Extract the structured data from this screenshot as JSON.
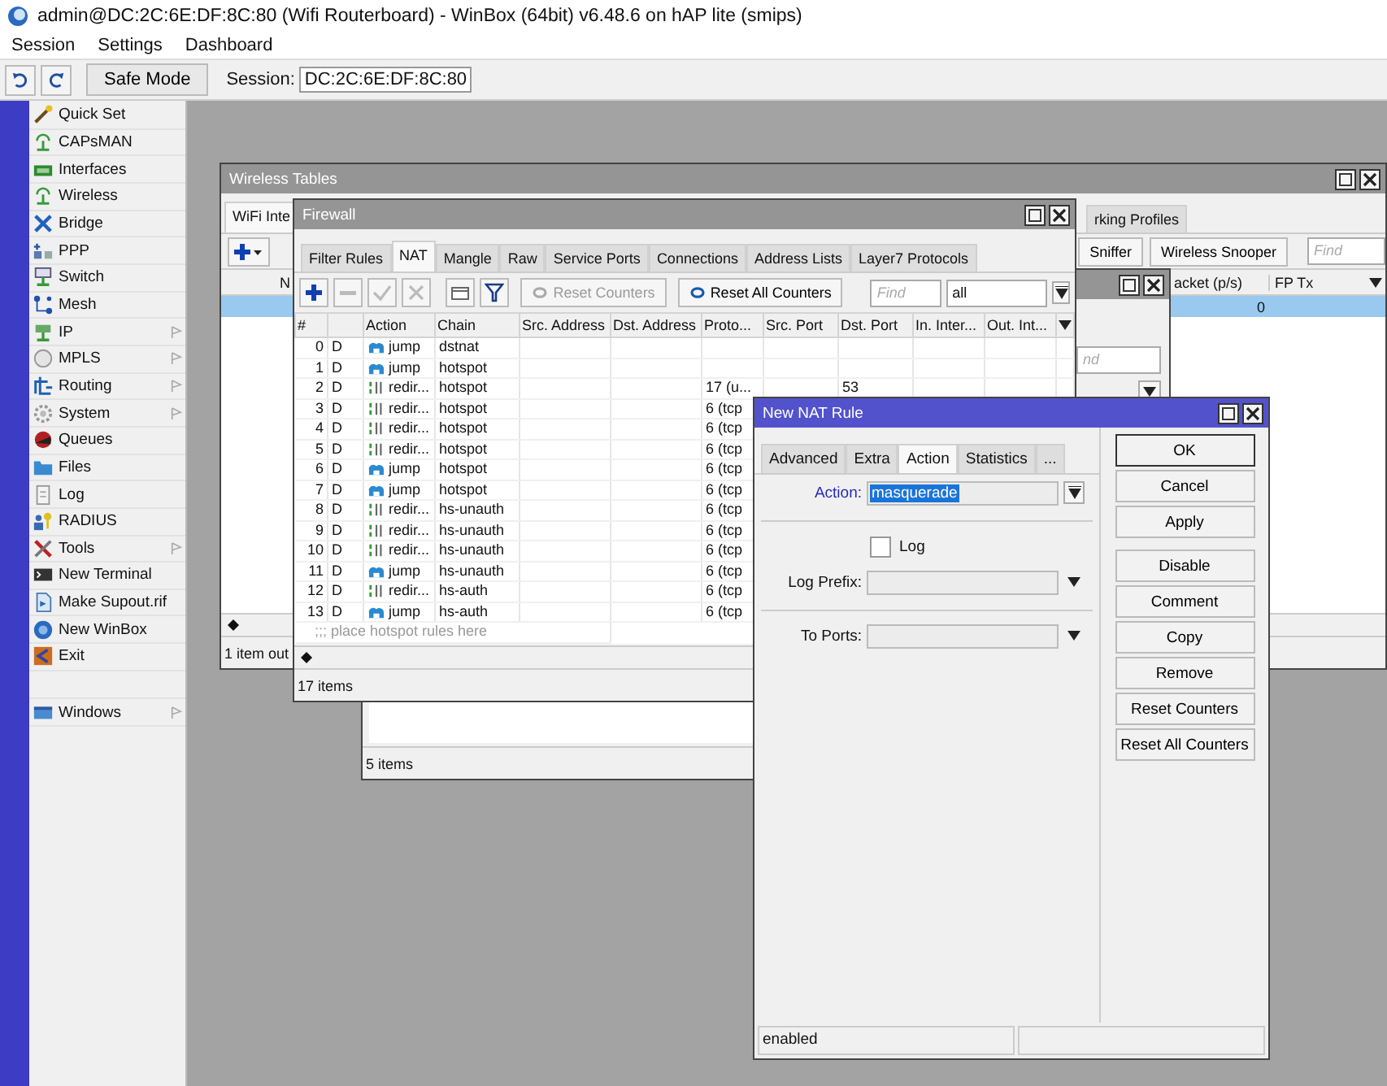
{
  "app": {
    "title": "admin@DC:2C:6E:DF:8C:80 (Wifi Routerboard) - WinBox (64bit) v6.48.6 on hAP lite (smips)"
  },
  "menu": [
    "Session",
    "Settings",
    "Dashboard"
  ],
  "toolbar": {
    "safe_mode": "Safe Mode",
    "session_label": "Session:",
    "session_value": "DC:2C:6E:DF:8C:80"
  },
  "sidebar": {
    "items": [
      {
        "label": "Quick Set",
        "submenu": false
      },
      {
        "label": "CAPsMAN",
        "submenu": false
      },
      {
        "label": "Interfaces",
        "submenu": false
      },
      {
        "label": "Wireless",
        "submenu": false
      },
      {
        "label": "Bridge",
        "submenu": false
      },
      {
        "label": "PPP",
        "submenu": false
      },
      {
        "label": "Switch",
        "submenu": false
      },
      {
        "label": "Mesh",
        "submenu": false
      },
      {
        "label": "IP",
        "submenu": true
      },
      {
        "label": "MPLS",
        "submenu": true
      },
      {
        "label": "Routing",
        "submenu": true
      },
      {
        "label": "System",
        "submenu": true
      },
      {
        "label": "Queues",
        "submenu": false
      },
      {
        "label": "Files",
        "submenu": false
      },
      {
        "label": "Log",
        "submenu": false
      },
      {
        "label": "RADIUS",
        "submenu": false
      },
      {
        "label": "Tools",
        "submenu": true
      },
      {
        "label": "New Terminal",
        "submenu": false
      },
      {
        "label": "Make Supout.rif",
        "submenu": false
      },
      {
        "label": "New WinBox",
        "submenu": false
      },
      {
        "label": "Exit",
        "submenu": false
      }
    ],
    "bottom_items": [
      {
        "label": "Windows",
        "submenu": true
      }
    ]
  },
  "wireless_tables": {
    "title": "Wireless Tables",
    "active": false,
    "tabs": [
      {
        "label": "WiFi Inte",
        "selected": true
      },
      {
        "label": "rking Profiles",
        "selected": false
      }
    ],
    "buttons": [
      "Sniffer",
      "Wireless Snooper"
    ],
    "find_placeholder": "Find",
    "columns": [
      "N",
      "acket (p/s)",
      "FP Tx"
    ],
    "rows": [
      {
        "selected": true,
        "column_2": "0"
      }
    ],
    "status": "1 item out"
  },
  "back_window": {
    "active": false,
    "find_placeholder": "nd",
    "status": "5 items"
  },
  "firewall": {
    "title": "Firewall",
    "active": false,
    "tabs": [
      {
        "label": "Filter Rules",
        "selected": false
      },
      {
        "label": "NAT",
        "selected": true
      },
      {
        "label": "Mangle",
        "selected": false
      },
      {
        "label": "Raw",
        "selected": false
      },
      {
        "label": "Service Ports",
        "selected": false
      },
      {
        "label": "Connections",
        "selected": false
      },
      {
        "label": "Address Lists",
        "selected": false
      },
      {
        "label": "Layer7 Protocols",
        "selected": false
      }
    ],
    "counter_buttons": [
      {
        "label": "Reset Counters",
        "disabled": true
      },
      {
        "label": "Reset All Counters",
        "disabled": false
      }
    ],
    "find_placeholder": "Find",
    "filter_value": "all",
    "columns": [
      "#",
      "Action",
      "Chain",
      "Src. Address",
      "Dst. Address",
      "Proto...",
      "Src. Port",
      "Dst. Port",
      "In. Inter...",
      "Out. Int..."
    ],
    "rows": [
      {
        "number": "0",
        "flag": "D",
        "kind": "jump",
        "action": "jump",
        "chain": "dstnat"
      },
      {
        "number": "1",
        "flag": "D",
        "kind": "jump",
        "action": "jump",
        "chain": "hotspot"
      },
      {
        "number": "2",
        "flag": "D",
        "kind": "redirect",
        "action": "redir...",
        "chain": "hotspot",
        "proto": "17 (u...",
        "dst_port": "53"
      },
      {
        "number": "3",
        "flag": "D",
        "kind": "redirect",
        "action": "redir...",
        "chain": "hotspot",
        "proto": "6 (tcp"
      },
      {
        "number": "4",
        "flag": "D",
        "kind": "redirect",
        "action": "redir...",
        "chain": "hotspot",
        "proto": "6 (tcp"
      },
      {
        "number": "5",
        "flag": "D",
        "kind": "redirect",
        "action": "redir...",
        "chain": "hotspot",
        "proto": "6 (tcp"
      },
      {
        "number": "6",
        "flag": "D",
        "kind": "jump",
        "action": "jump",
        "chain": "hotspot",
        "proto": "6 (tcp"
      },
      {
        "number": "7",
        "flag": "D",
        "kind": "jump",
        "action": "jump",
        "chain": "hotspot",
        "proto": "6 (tcp"
      },
      {
        "number": "8",
        "flag": "D",
        "kind": "redirect",
        "action": "redir...",
        "chain": "hs-unauth",
        "proto": "6 (tcp"
      },
      {
        "number": "9",
        "flag": "D",
        "kind": "redirect",
        "action": "redir...",
        "chain": "hs-unauth",
        "proto": "6 (tcp"
      },
      {
        "number": "10",
        "flag": "D",
        "kind": "redirect",
        "action": "redir...",
        "chain": "hs-unauth",
        "proto": "6 (tcp"
      },
      {
        "number": "11",
        "flag": "D",
        "kind": "jump",
        "action": "jump",
        "chain": "hs-unauth",
        "proto": "6 (tcp"
      },
      {
        "number": "12",
        "flag": "D",
        "kind": "redirect",
        "action": "redir...",
        "chain": "hs-auth",
        "proto": "6 (tcp"
      },
      {
        "number": "13",
        "flag": "D",
        "kind": "jump",
        "action": "jump",
        "chain": "hs-auth",
        "proto": "6 (tcp"
      }
    ],
    "comment": ";;; place hotspot rules here",
    "status": "17 items"
  },
  "nat_rule": {
    "title": "New NAT Rule",
    "active": true,
    "tabs": [
      {
        "label": "Advanced",
        "selected": false
      },
      {
        "label": "Extra",
        "selected": false
      },
      {
        "label": "Action",
        "selected": true
      },
      {
        "label": "Statistics",
        "selected": false
      },
      {
        "label": "...",
        "selected": false
      }
    ],
    "field_groups": [
      [
        {
          "kind": "select",
          "label": "Action:",
          "value": "masquerade",
          "highlight": true
        }
      ],
      [
        {
          "kind": "checkbox",
          "label": "Log",
          "checked": false
        },
        {
          "kind": "combo",
          "label": "Log Prefix:",
          "highlight": false
        }
      ],
      [
        {
          "kind": "combo",
          "label": "To Ports:",
          "highlight": false
        }
      ]
    ],
    "button_groups": [
      [
        {
          "label": "OK",
          "default": true
        },
        {
          "label": "Cancel",
          "default": false
        },
        {
          "label": "Apply",
          "default": false
        }
      ],
      [
        {
          "label": "Disable",
          "default": false
        },
        {
          "label": "Comment",
          "default": false
        },
        {
          "label": "Copy",
          "default": false
        },
        {
          "label": "Remove",
          "default": false
        },
        {
          "label": "Reset Counters",
          "default": false
        },
        {
          "label": "Reset All Counters",
          "default": false
        }
      ]
    ],
    "status": "enabled"
  }
}
